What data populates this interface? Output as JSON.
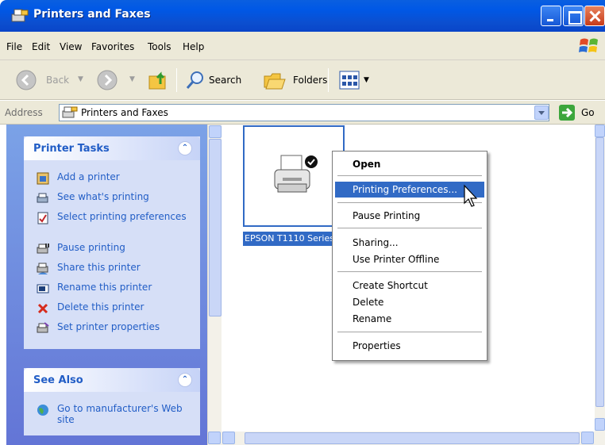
{
  "window": {
    "title": "Printers and Faxes"
  },
  "menubar": {
    "items": [
      "File",
      "Edit",
      "View",
      "Favorites",
      "Tools",
      "Help"
    ]
  },
  "toolbar": {
    "back_label": "Back",
    "search_label": "Search",
    "folders_label": "Folders"
  },
  "address": {
    "label": "Address",
    "value": "Printers and Faxes",
    "go_label": "Go"
  },
  "printer_tasks": {
    "title": "Printer Tasks",
    "items": [
      {
        "label": "Add a printer",
        "icon": "add-printer-icon"
      },
      {
        "label": "See what's printing",
        "icon": "print-queue-icon"
      },
      {
        "label": "Select printing preferences",
        "icon": "preferences-icon"
      },
      {
        "label": "Pause printing",
        "icon": "pause-printer-icon"
      },
      {
        "label": "Share this printer",
        "icon": "share-printer-icon"
      },
      {
        "label": "Rename this printer",
        "icon": "rename-printer-icon"
      },
      {
        "label": "Delete this printer",
        "icon": "delete-icon"
      },
      {
        "label": "Set printer properties",
        "icon": "printer-properties-icon"
      }
    ]
  },
  "see_also": {
    "title": "See Also",
    "items": [
      {
        "label": "Go to manufacturer's Web site",
        "icon": "globe-icon"
      }
    ]
  },
  "printer": {
    "name": "EPSON T1110 Series"
  },
  "context_menu": {
    "items": [
      "Open",
      "Printing Preferences...",
      "Pause Printing",
      "Sharing...",
      "Use Printer Offline",
      "Create Shortcut",
      "Delete",
      "Rename",
      "Properties"
    ],
    "highlighted": "Printing Preferences..."
  },
  "colors": {
    "title_bar": "#0a5fe0",
    "selection": "#316ac5",
    "task_link": "#215dc6",
    "task_pane": "#7ba2e7"
  }
}
